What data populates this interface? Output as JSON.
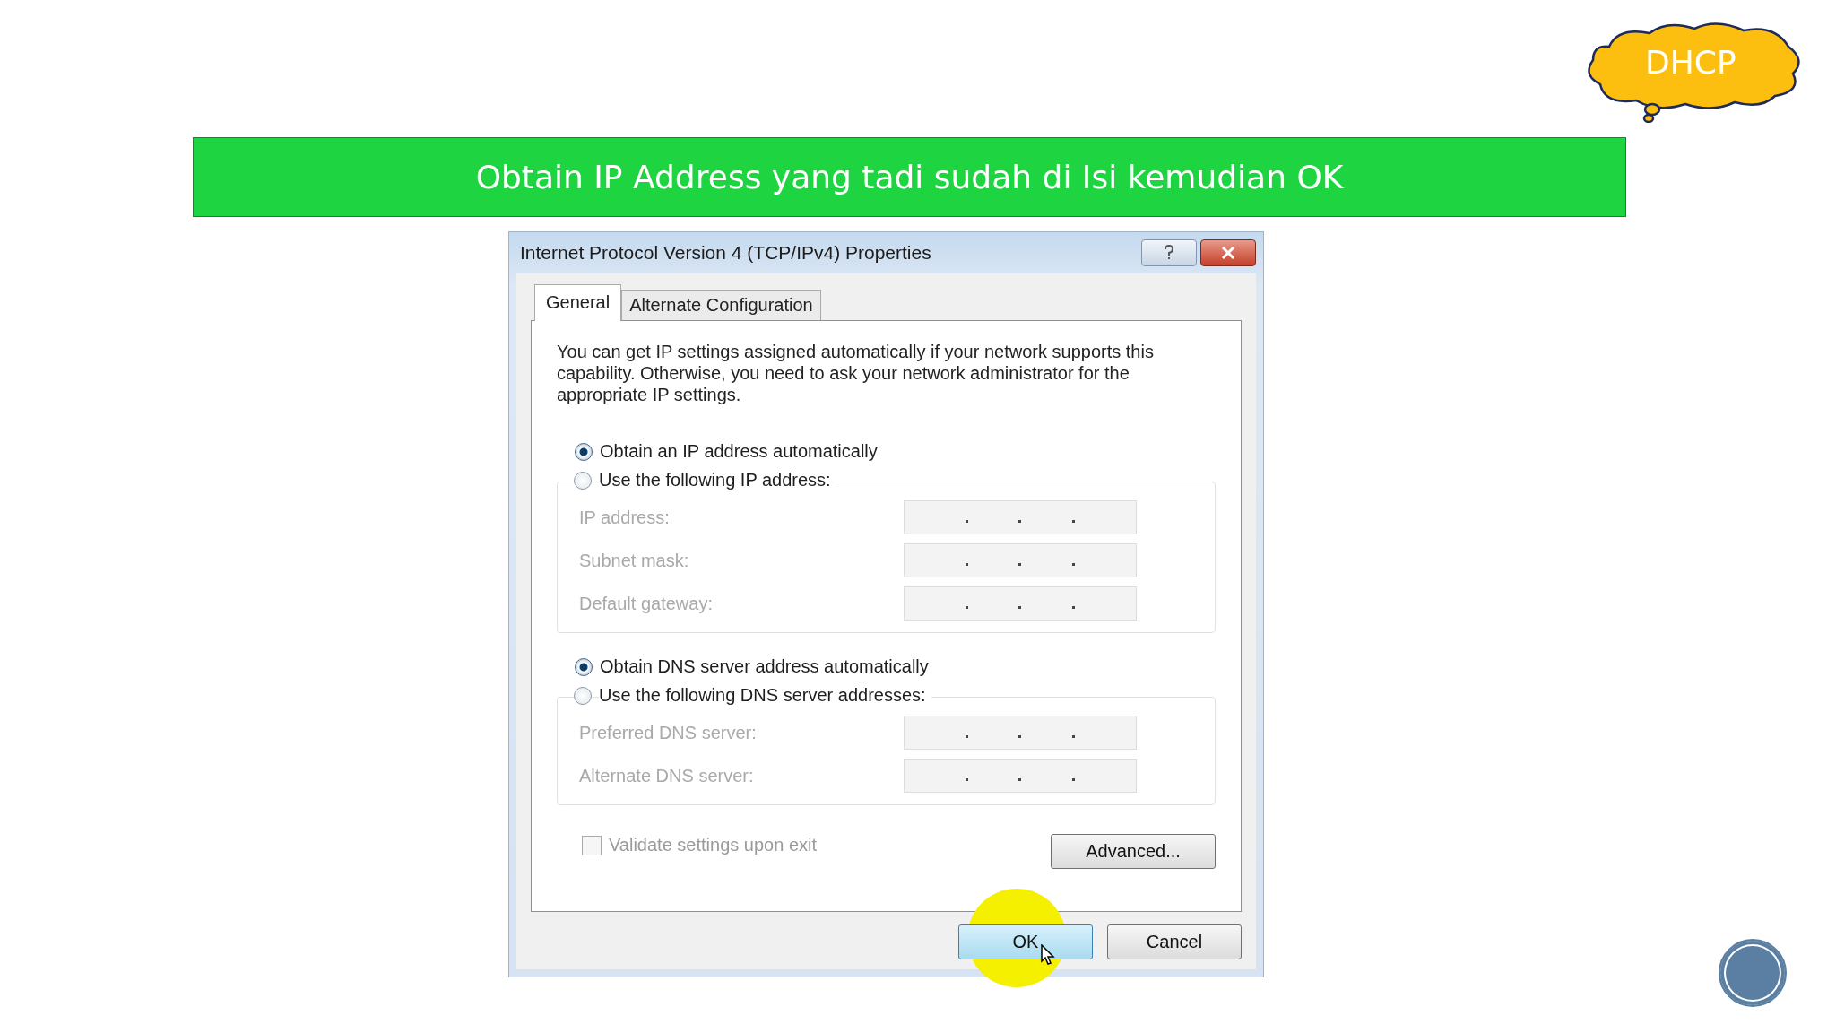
{
  "slide": {
    "banner": "Obtain IP Address yang tadi sudah di Isi kemudian OK",
    "callout": "DHCP"
  },
  "dialog": {
    "title": "Internet Protocol Version 4 (TCP/IPv4) Properties",
    "tabs": [
      {
        "label": "General",
        "selected": true
      },
      {
        "label": "Alternate Configuration",
        "selected": false
      }
    ],
    "description": "You can get IP settings assigned automatically if your network supports this capability. Otherwise, you need to ask your network administrator for the appropriate IP settings.",
    "groups": [
      {
        "auto": {
          "label": "Obtain an IP address automatically",
          "selected": true
        },
        "manual": {
          "label": "Use the following IP address:",
          "selected": false
        },
        "fields": [
          {
            "label": "IP address:",
            "disabled": true
          },
          {
            "label": "Subnet mask:",
            "disabled": true
          },
          {
            "label": "Default gateway:",
            "disabled": true
          }
        ]
      },
      {
        "auto": {
          "label": "Obtain DNS server address automatically",
          "selected": true
        },
        "manual": {
          "label": "Use the following DNS server addresses:",
          "selected": false
        },
        "fields": [
          {
            "label": "Preferred DNS server:",
            "disabled": true
          },
          {
            "label": "Alternate DNS server:",
            "disabled": true
          }
        ]
      }
    ],
    "validate": {
      "label": "Validate settings upon exit",
      "checked": false,
      "disabled": true
    },
    "advanced": "Advanced...",
    "ok": "OK",
    "cancel": "Cancel"
  }
}
